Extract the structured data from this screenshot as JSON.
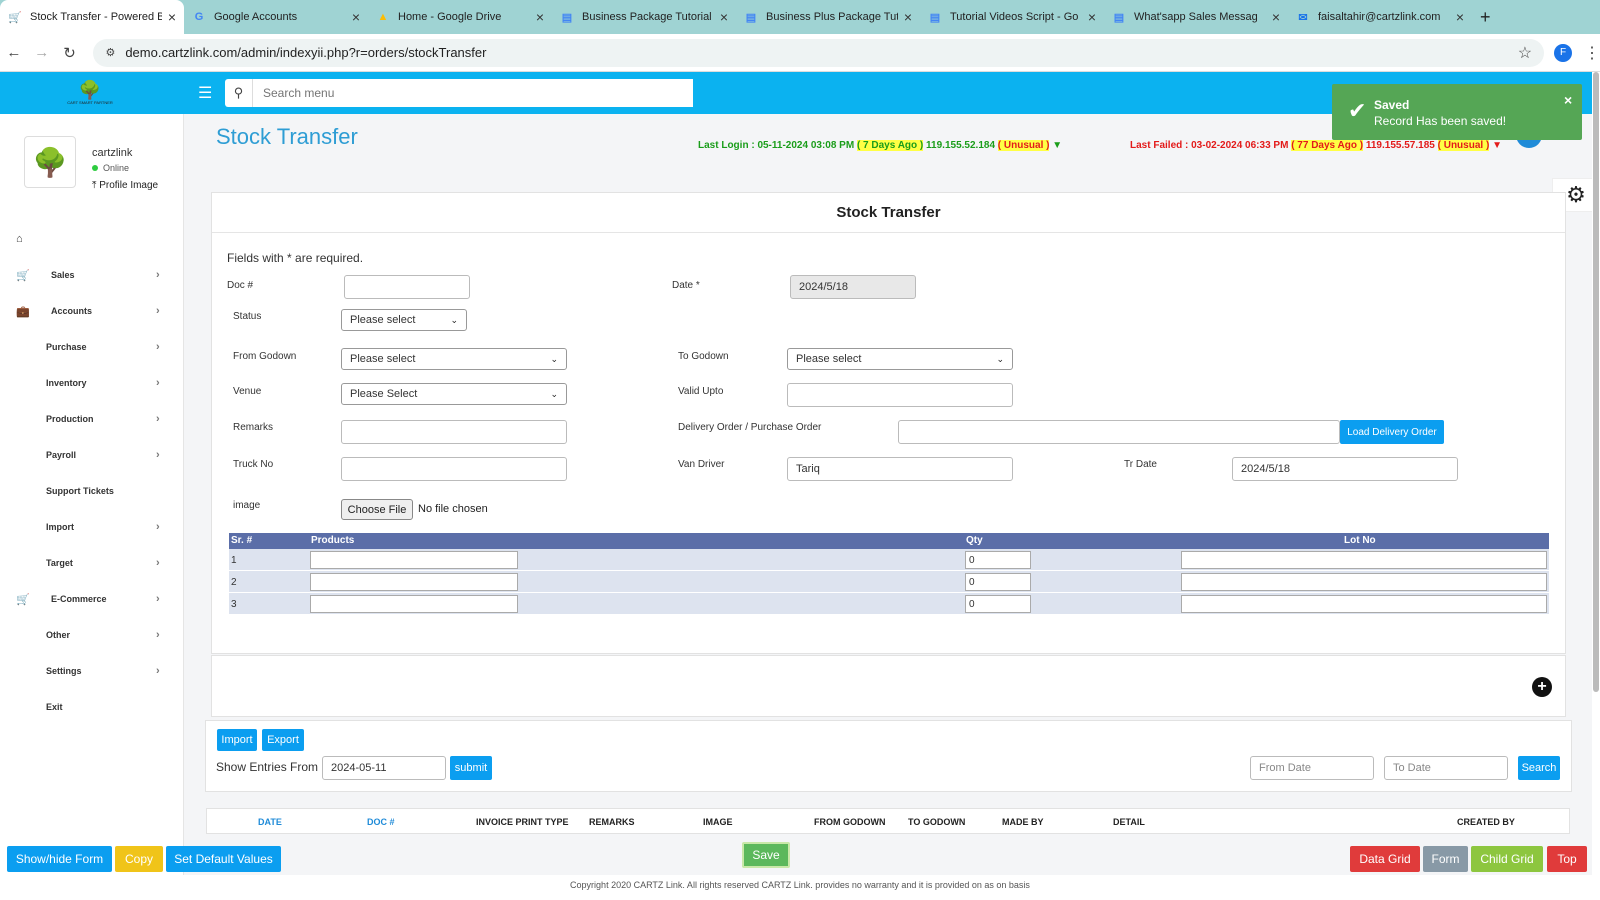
{
  "browser": {
    "tabs": [
      {
        "title": "Stock Transfer - Powered B",
        "icon": "cart-icon",
        "color": "#2a8a2a"
      },
      {
        "title": "Google Accounts",
        "icon": "google-icon",
        "color": "#4285f4"
      },
      {
        "title": "Home - Google Drive",
        "icon": "drive-icon",
        "color": "#fbbc04"
      },
      {
        "title": "Business Package Tutorial",
        "icon": "docs-icon",
        "color": "#4285f4"
      },
      {
        "title": "Business Plus Package Tut",
        "icon": "docs-icon",
        "color": "#4285f4"
      },
      {
        "title": "Tutorial Videos Script - Go",
        "icon": "docs-icon",
        "color": "#4285f4"
      },
      {
        "title": "What'sapp Sales Messag",
        "icon": "docs-icon",
        "color": "#4285f4"
      },
      {
        "title": "faisaltahir@cartzlink.com",
        "icon": "mail-icon",
        "color": "#1a73e8"
      }
    ],
    "url": "demo.cartzlink.com/admin/indexyii.php?r=orders/stockTransfer",
    "profile_initial": "F"
  },
  "header": {
    "search_placeholder": "Search menu",
    "logo_text": "CART SMART PARTNER"
  },
  "user": {
    "name": "cartzlink",
    "status": "Online",
    "profile_link": "Profile Image"
  },
  "sidebar": {
    "items": [
      {
        "label": "",
        "icon": "home-icon",
        "has_chevron": false
      },
      {
        "label": "Sales",
        "icon": "cart-icon",
        "has_chevron": true
      },
      {
        "label": "Accounts",
        "icon": "briefcase-icon",
        "has_chevron": true
      },
      {
        "label": "Purchase",
        "icon": "",
        "has_chevron": true
      },
      {
        "label": "Inventory",
        "icon": "",
        "has_chevron": true
      },
      {
        "label": "Production",
        "icon": "",
        "has_chevron": true
      },
      {
        "label": "Payroll",
        "icon": "",
        "has_chevron": true
      },
      {
        "label": "Support Tickets",
        "icon": "",
        "has_chevron": false
      },
      {
        "label": "Import",
        "icon": "",
        "has_chevron": true
      },
      {
        "label": "Target",
        "icon": "",
        "has_chevron": true
      },
      {
        "label": "E-Commerce",
        "icon": "cart-icon",
        "has_chevron": true
      },
      {
        "label": "Other",
        "icon": "",
        "has_chevron": true
      },
      {
        "label": "Settings",
        "icon": "",
        "has_chevron": true
      },
      {
        "label": "Exit",
        "icon": "",
        "has_chevron": false
      }
    ]
  },
  "page": {
    "title": "Stock Transfer",
    "last_login": {
      "prefix": "Last Login : 05-11-2024 03:08 PM",
      "ago": "( 7 Days Ago )",
      "ip": "119.155.52.184",
      "flag": "( Unusual )"
    },
    "last_failed": {
      "prefix": "Last Failed : 03-02-2024 06:33 PM",
      "ago": "( 77 Days Ago )",
      "ip": "119.155.57.185",
      "flag": "( Unusual )"
    }
  },
  "toast": {
    "title": "Saved",
    "message": "Record Has been saved!"
  },
  "form": {
    "heading": "Stock Transfer",
    "required_note": "Fields with * are required.",
    "doc_label": "Doc #",
    "doc_value": "",
    "date_label": "Date *",
    "date_value": "2024/5/18",
    "status_label": "Status",
    "status_value": "Please select",
    "from_godown_label": "From Godown",
    "from_godown_value": "Please select",
    "to_godown_label": "To Godown",
    "to_godown_value": "Please select",
    "venue_label": "Venue",
    "venue_value": "Please Select",
    "valid_upto_label": "Valid Upto",
    "valid_upto_value": "",
    "remarks_label": "Remarks",
    "delivery_order_label": "Delivery Order / Purchase Order",
    "load_delivery_button": "Load Delivery Order",
    "truck_label": "Truck No",
    "van_driver_label": "Van Driver",
    "van_driver_value": "Tariq",
    "tr_date_label": "Tr Date",
    "tr_date_value": "2024/5/18",
    "image_label": "image",
    "choose_file": "Choose File",
    "no_file": "No file chosen"
  },
  "grid": {
    "headers": {
      "sr": "Sr. #",
      "products": "Products",
      "qty": "Qty",
      "lot": "Lot No"
    },
    "rows": [
      {
        "sr": "1",
        "qty": "0"
      },
      {
        "sr": "2",
        "qty": "0"
      },
      {
        "sr": "3",
        "qty": "0"
      }
    ]
  },
  "listing": {
    "import_button": "Import",
    "export_button": "Export",
    "show_entries_label": "Show Entries From",
    "show_entries_value": "2024-05-11",
    "submit_button": "submit",
    "from_date_placeholder": "From Date",
    "to_date_placeholder": "To Date",
    "search_button": "Search",
    "columns": [
      "DATE",
      "DOC #",
      "INVOICE PRINT TYPE",
      "REMARKS",
      "IMAGE",
      "FROM GODOWN",
      "TO GODOWN",
      "MADE BY",
      "DETAIL",
      "CREATED BY"
    ]
  },
  "bottom_bar": {
    "show_hide": "Show/hide Form",
    "copy": "Copy",
    "set_default": "Set Default Values",
    "save": "Save",
    "data_grid": "Data Grid",
    "form": "Form",
    "child_grid": "Child Grid",
    "top": "Top"
  },
  "footer": {
    "copyright": "Copyright 2020 CARTZ Link. All rights reserved CARTZ Link. provides no warranty and it is provided on as on basis"
  },
  "colors": {
    "header": "#0bb2f0",
    "accent": "#2e9dd4",
    "grid_header": "#5b6ea8",
    "toast": "#55a655",
    "save": "#5cb85c",
    "copy": "#f0c419",
    "data_grid": "#e03b3b",
    "form_btn": "#8899a6",
    "child_grid": "#8dc63f"
  }
}
